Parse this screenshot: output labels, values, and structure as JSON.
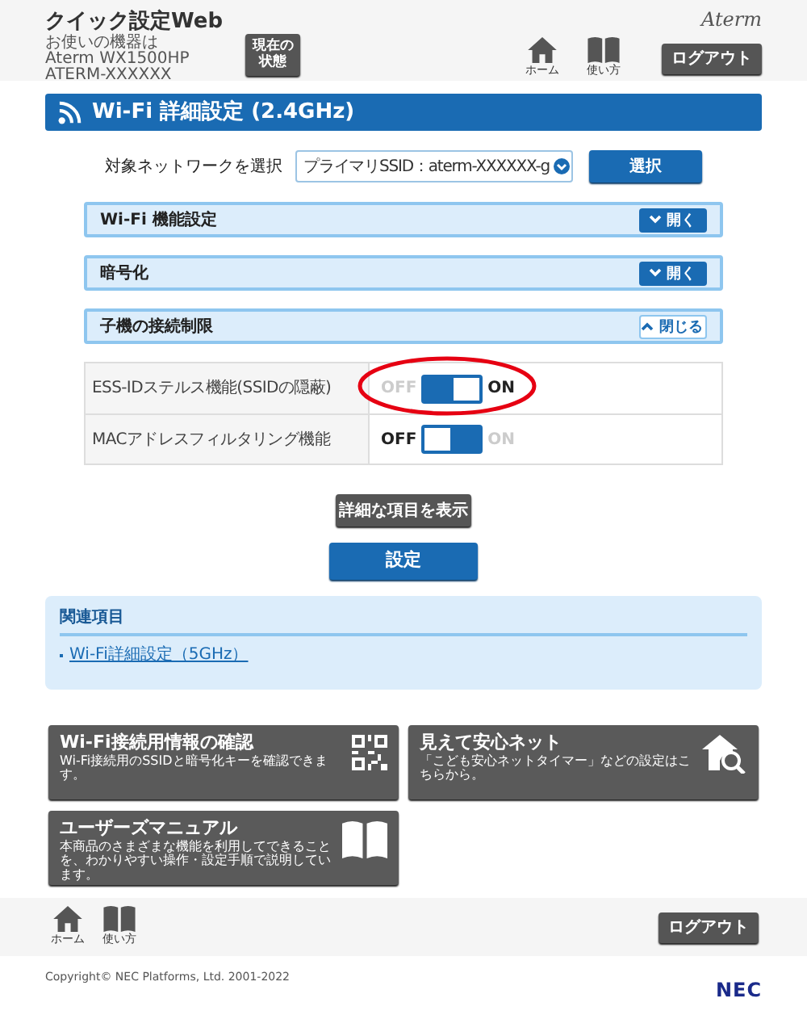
{
  "header": {
    "title": "クイック設定Web",
    "device_lines": [
      "お使いの機器は",
      "Aterm WX1500HP",
      "ATERM-XXXXXX"
    ],
    "status_button": [
      "現在の",
      "状態"
    ],
    "brand": "Aterm",
    "nav": [
      {
        "label": "ホーム",
        "kind": "home"
      },
      {
        "label": "使い方",
        "kind": "manual"
      }
    ],
    "logout": "ログアウト"
  },
  "page_title": "Wi-Fi 詳細設定 (2.4GHz)",
  "network_select": {
    "label": "対象ネットワークを選択",
    "value": "プライマリSSID：aterm-XXXXXX-g",
    "button": "選択"
  },
  "sections": [
    {
      "title": "Wi-Fi 機能設定",
      "expanded": false,
      "toggle_label": "開く"
    },
    {
      "title": "暗号化",
      "expanded": false,
      "toggle_label": "開く"
    },
    {
      "title": "子機の接続制限",
      "expanded": true,
      "toggle_label": "閉じる"
    }
  ],
  "settings": [
    {
      "name": "ESS-IDステルス機能(SSIDの隠蔽)",
      "on": true,
      "off_label": "OFF",
      "on_label": "ON",
      "highlighted": true
    },
    {
      "name": "MACアドレスフィルタリング機能",
      "on": false,
      "off_label": "OFF",
      "on_label": "ON",
      "highlighted": false
    }
  ],
  "detail_button": "詳細な項目を表示",
  "submit_button": "設定",
  "related": {
    "title": "関連項目",
    "links": [
      "Wi-Fi詳細設定（5GHz）"
    ]
  },
  "tiles": [
    {
      "title": "Wi-Fi接続用情報の確認",
      "description": "Wi-Fi接続用のSSIDと暗号化キーを確認できます。",
      "kind": "qr"
    },
    {
      "title": "見えて安心ネット",
      "description": "「こども安心ネットタイマー」などの設定はこちらから。",
      "kind": "house"
    },
    {
      "title": "ユーザーズマニュアル",
      "description": "本商品のさまざまな機能を利用してできることを、わかりやすい操作・設定手順で説明しています。",
      "kind": "book"
    }
  ],
  "footer": {
    "nav": [
      {
        "label": "ホーム",
        "kind": "home"
      },
      {
        "label": "使い方",
        "kind": "manual"
      }
    ],
    "logout": "ログアウト",
    "copyright": "Copyright© NEC Platforms, Ltd. 2001-2022",
    "brand": "NEC"
  }
}
